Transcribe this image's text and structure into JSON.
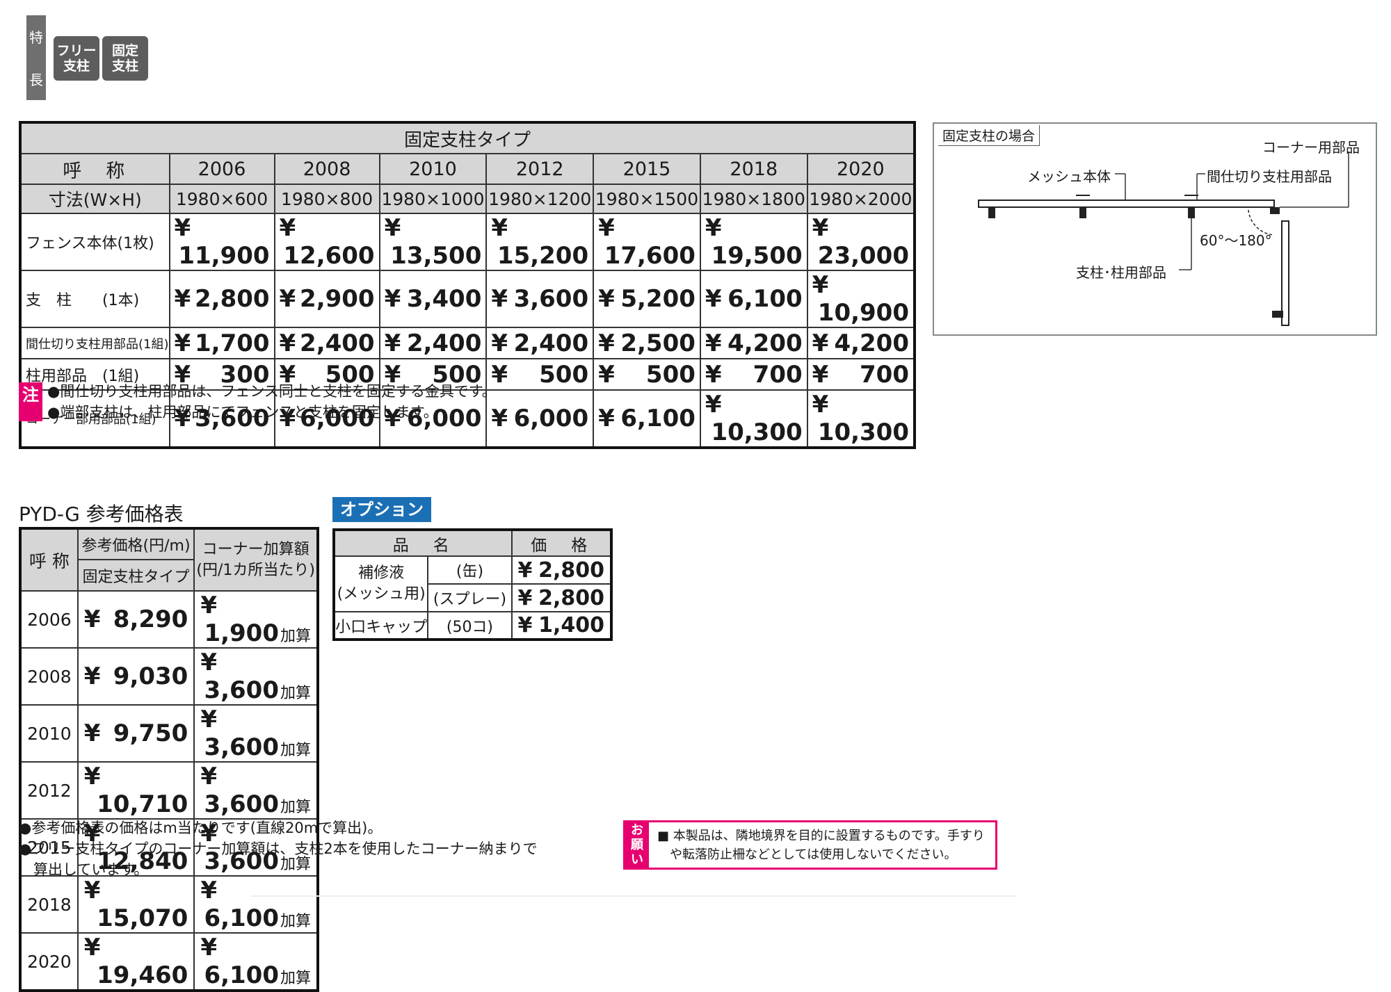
{
  "features": {
    "side_label": [
      "特",
      "長"
    ],
    "tags": [
      {
        "line1": "フリー",
        "line2": "支柱"
      },
      {
        "line1": "固定",
        "line2": "支柱"
      }
    ]
  },
  "main_table": {
    "title": "固定支柱タイプ",
    "name_label": "呼　称",
    "size_label": "寸法(W×H)",
    "codes": [
      "2006",
      "2008",
      "2010",
      "2012",
      "2015",
      "2018",
      "2020"
    ],
    "sizes": [
      "1980×600",
      "1980×800",
      "1980×1000",
      "1980×1200",
      "1980×1500",
      "1980×1800",
      "1980×2000"
    ],
    "rows": [
      {
        "label": "フェンス本体(1枚)",
        "prices": [
          "11,900",
          "12,600",
          "13,500",
          "15,200",
          "17,600",
          "19,500",
          "23,000"
        ]
      },
      {
        "label": "支　柱　　(1本)",
        "prices": [
          "2,800",
          "2,900",
          "3,400",
          "3,600",
          "5,200",
          "6,100",
          "10,900"
        ]
      },
      {
        "label": "間仕切り支柱用部品(1組)",
        "prices": [
          "1,700",
          "2,400",
          "2,400",
          "2,400",
          "2,500",
          "4,200",
          "4,200"
        ]
      },
      {
        "label": "柱用部品　(1組)",
        "prices": [
          "300",
          "500",
          "500",
          "500",
          "500",
          "700",
          "700"
        ]
      },
      {
        "label": "コーナー部用部品(1組)",
        "prices": [
          "3,600",
          "6,000",
          "6,000",
          "6,000",
          "6,100",
          "10,300",
          "10,300"
        ]
      }
    ],
    "currency": "¥"
  },
  "notes": {
    "tag": "注",
    "lines": [
      "●間仕切り支柱用部品は、フェンス同士と支柱を固定する金具です。",
      "●端部支柱は、柱用部品にてフェンスと支柱を固定します。"
    ]
  },
  "diagram": {
    "title": "固定支柱の場合",
    "labels": {
      "corner": "コーナー用部品",
      "mesh": "メッシュ本体",
      "partition": "間仕切り支柱用部品",
      "angle": "60°〜180°",
      "post": "支柱･柱用部品"
    }
  },
  "ref_table": {
    "title": "PYD-G  参考価格表",
    "name_label": "呼 称",
    "price_label": "参考価格(円/m)",
    "type_label": "固定支柱タイプ",
    "corner_label_1": "コーナー加算額",
    "corner_label_2": "(円/1カ所当たり)",
    "kasan": "加算",
    "rows": [
      {
        "code": "2006",
        "price": "8,290",
        "corner": "1,900"
      },
      {
        "code": "2008",
        "price": "9,030",
        "corner": "3,600"
      },
      {
        "code": "2010",
        "price": "9,750",
        "corner": "3,600"
      },
      {
        "code": "2012",
        "price": "10,710",
        "corner": "3,600"
      },
      {
        "code": "2015",
        "price": "12,840",
        "corner": "3,600"
      },
      {
        "code": "2018",
        "price": "15,070",
        "corner": "6,100"
      },
      {
        "code": "2020",
        "price": "19,460",
        "corner": "6,100"
      }
    ],
    "notes": [
      "●参考価格表の価格はm当たりです(直線20mで算出)。",
      "●フリー支柱タイプのコーナー加算額は、支柱2本を使用したコーナー納まりで",
      "　算出しています。"
    ]
  },
  "option": {
    "badge": "オプション",
    "name_header": "品　名",
    "price_header": "価　格",
    "repair_name_1": "補修液",
    "repair_name_2": "(メッシュ用)",
    "items": [
      {
        "variant": "(缶)",
        "price": "2,800"
      },
      {
        "variant": "(スプレー)",
        "price": "2,800"
      }
    ],
    "cap": {
      "name": "小口キャップ",
      "variant": "(50コ)",
      "price": "1,400"
    }
  },
  "request": {
    "tag": [
      "お",
      "願",
      "い"
    ],
    "lines": [
      "■ 本製品は、隣地境界を目的に設置するものです。手すり",
      "　や転落防止柵などとしては使用しないでください。"
    ]
  }
}
